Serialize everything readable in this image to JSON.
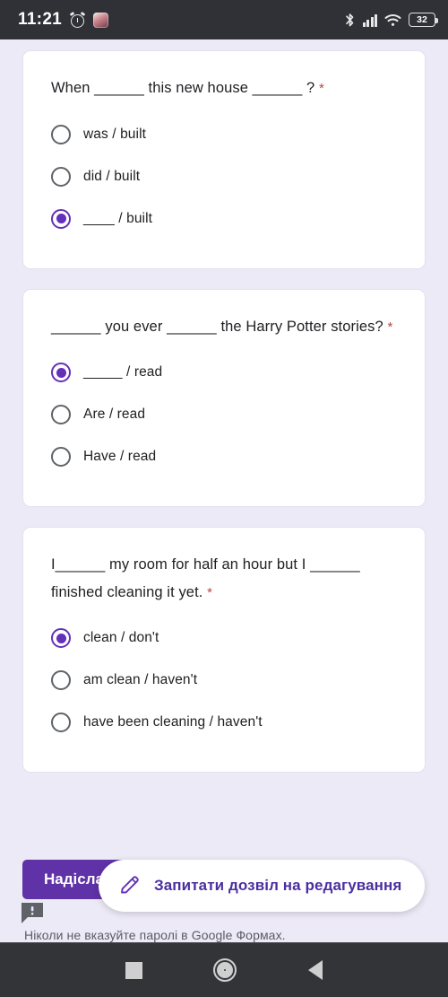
{
  "status_bar": {
    "time": "11:21",
    "alarm_icon": "alarm-clock-icon",
    "app_icon": "app-notification-icon",
    "bluetooth_icon": "bluetooth-icon",
    "signal_icon": "cellular-signal-icon",
    "wifi_icon": "wifi-icon",
    "battery_level": "32"
  },
  "colors": {
    "background": "#edeaf7",
    "card": "#ffffff",
    "accent_purple": "#6430b8",
    "submit_purple": "#5f32a8",
    "required_red": "#b5483e",
    "status_bar": "#2f3136",
    "nav_bar": "#323438"
  },
  "form": {
    "questions": [
      {
        "text": "When ______ this new house ______ ?",
        "required_marker": "*",
        "options": [
          {
            "label": "was / built",
            "selected": false
          },
          {
            "label": "did / built",
            "selected": false
          },
          {
            "label": "____ / built",
            "selected": true
          }
        ]
      },
      {
        "text": "______ you ever ______ the Harry Potter stories?",
        "required_marker": "*",
        "options": [
          {
            "label": "_____ / read",
            "selected": true
          },
          {
            "label": "Are / read",
            "selected": false
          },
          {
            "label": "Have / read",
            "selected": false
          }
        ]
      },
      {
        "text": "I______ my room for half an hour but I ______ finished cleaning it yet.",
        "required_marker": "*",
        "options": [
          {
            "label": "clean / don't",
            "selected": true
          },
          {
            "label": "am clean / haven't",
            "selected": false
          },
          {
            "label": "have been cleaning / haven't",
            "selected": false
          }
        ]
      }
    ],
    "submit_label": "Надіслати",
    "report_icon": "report-abuse-icon",
    "footer_note": "Ніколи не вказуйте паролі в Google Формах."
  },
  "permission_pill": {
    "icon": "pencil-icon",
    "label": "Запитати дозвіл на редагування"
  },
  "nav_bar": {
    "recents": "recents-square-icon",
    "home": "home-circle-icon",
    "back": "back-triangle-icon"
  }
}
